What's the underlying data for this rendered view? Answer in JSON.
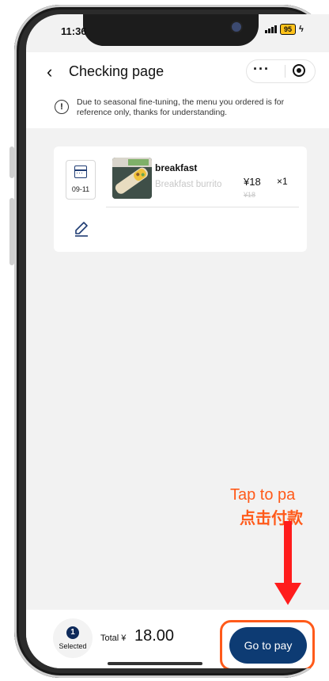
{
  "status_bar": {
    "time": "11:36",
    "battery": "95",
    "charging": "ϟ"
  },
  "header": {
    "back_icon": "‹",
    "title": "Checking page",
    "more_icon": "···"
  },
  "notice": {
    "icon": "!",
    "text": "Due to seasonal fine-tuning, the menu you ordered is for reference only, thanks for understanding."
  },
  "order_item": {
    "date": "09-11",
    "name": "breakfast",
    "description": "Breakfast burrito",
    "price": "¥18",
    "original_price": "¥18",
    "quantity": "×1"
  },
  "annotation": {
    "english": "Tap to pa",
    "chinese": "点击付款"
  },
  "bottom_bar": {
    "selected_count": "1",
    "selected_label": "Selected",
    "total_label": "Total ¥",
    "total_amount": "18.00",
    "pay_button": "Go to pay"
  },
  "colors": {
    "brand": "#0d3b73",
    "annotation": "#ff5a1a",
    "arrow": "#ff1c1c"
  }
}
